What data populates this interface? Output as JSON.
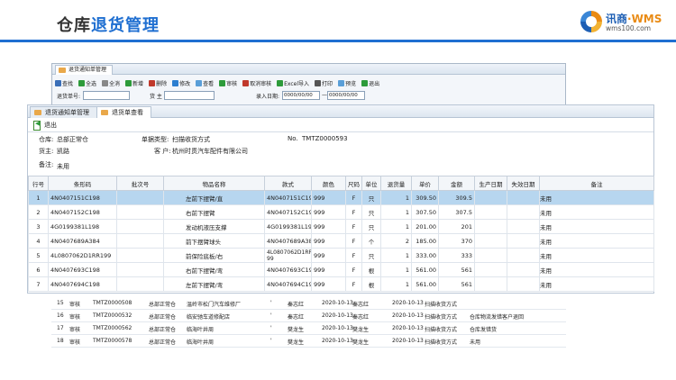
{
  "slide": {
    "title_part1": "仓库",
    "title_part2": "退货管理",
    "logo_text": "讯商",
    "logo_wms": "·WMS",
    "logo_url": "wms100.com"
  },
  "colors": {
    "accent": "#1f6fd1",
    "selected_row": "#b7d6ef",
    "logo_orange": "#e98b15"
  },
  "bg_window": {
    "tab_label": "退货通知单管理",
    "toolbar": [
      {
        "label": "查找",
        "icon": "search-icon"
      },
      {
        "label": "全选",
        "icon": "checkbox-icon"
      },
      {
        "label": "全消",
        "icon": "checkbox-empty-icon"
      },
      {
        "label": "新增",
        "icon": "add-icon"
      },
      {
        "label": "删除",
        "icon": "delete-icon"
      },
      {
        "label": "修改",
        "icon": "edit-icon"
      },
      {
        "label": "查看",
        "icon": "view-icon"
      },
      {
        "label": "审核",
        "icon": "check-icon"
      },
      {
        "label": "取消审核",
        "icon": "cancel-icon"
      },
      {
        "label": "Excel导入",
        "icon": "excel-icon"
      },
      {
        "label": "打印",
        "icon": "print-icon"
      },
      {
        "label": "预览",
        "icon": "preview-icon"
      },
      {
        "label": "退出",
        "icon": "exit-icon"
      }
    ],
    "search": {
      "order_no_label": "退货单号:",
      "owner_label": "货 主",
      "date_label": "录入日期:",
      "date_from": "0000/00/00",
      "date_to": "0000/00/00",
      "range_sep": "—"
    }
  },
  "window": {
    "tabs": [
      {
        "label": "退货通知单管理"
      },
      {
        "label": "退货单查看"
      }
    ],
    "exit_label": "退出",
    "header": {
      "warehouse_label": "仓库:",
      "warehouse_value": "总部正常仓",
      "type_label": "单据类型:",
      "type_value": "扫描收货方式",
      "no_label": "No.",
      "no_value": "TMTZ0000593",
      "owner_label": "货主:",
      "owner_value": "凯路",
      "customer_label": "客 户:",
      "customer_value": "杭州时贯汽车配件有限公司",
      "remark_label": "备注:",
      "remark_value": "未用"
    },
    "columns": [
      "行号",
      "条形码",
      "批次号",
      "物品名称",
      "款式",
      "颜色",
      "尺码",
      "单位",
      "退货量",
      "单价",
      "金额",
      "生产日期",
      "失效日期",
      "备注"
    ],
    "rows": [
      {
        "no": "1",
        "barcode": "4N0407151C198",
        "batch": "",
        "name": "左前下摆臂/直",
        "style": "4N0407151C198",
        "color": "999",
        "size": "F",
        "unit": "只",
        "qty": "1",
        "price": "309.50",
        "amount": "309.5",
        "mfg": "",
        "exp": "",
        "remark": "未用"
      },
      {
        "no": "2",
        "barcode": "4N0407152C198",
        "batch": "",
        "name": "右前下摆臂",
        "style": "4N0407152C198",
        "color": "999",
        "size": "F",
        "unit": "只",
        "qty": "1",
        "price": "307.50",
        "amount": "307.5",
        "mfg": "",
        "exp": "",
        "remark": "未用"
      },
      {
        "no": "3",
        "barcode": "4G0199381L198",
        "batch": "",
        "name": "发动机液压支撑",
        "style": "4G0199381L198",
        "color": "999",
        "size": "F",
        "unit": "只",
        "qty": "1",
        "price": "201.00",
        "amount": "201",
        "mfg": "",
        "exp": "",
        "remark": "未用"
      },
      {
        "no": "4",
        "barcode": "4N0407689A384",
        "batch": "",
        "name": "前下摆臂球头",
        "style": "4N0407689A384",
        "color": "999",
        "size": "F",
        "unit": "个",
        "qty": "2",
        "price": "185.00",
        "amount": "370",
        "mfg": "",
        "exp": "",
        "remark": "未用"
      },
      {
        "no": "5",
        "barcode": "4L0807062D1RR199",
        "batch": "",
        "name": "前保险底板/右",
        "style": "4L0807062D1RR1 99",
        "color": "999",
        "size": "F",
        "unit": "只",
        "qty": "1",
        "price": "333.00",
        "amount": "333",
        "mfg": "",
        "exp": "",
        "remark": "未用"
      },
      {
        "no": "6",
        "barcode": "4N0407693C198",
        "batch": "",
        "name": "右前下摆臂/弯",
        "style": "4N0407693C198",
        "color": "999",
        "size": "F",
        "unit": "根",
        "qty": "1",
        "price": "561.00",
        "amount": "561",
        "mfg": "",
        "exp": "",
        "remark": "未用"
      },
      {
        "no": "7",
        "barcode": "4N0407694C198",
        "batch": "",
        "name": "左前下摆臂/弯",
        "style": "4N0407694C198",
        "color": "999",
        "size": "F",
        "unit": "根",
        "qty": "1",
        "price": "561.00",
        "amount": "561",
        "mfg": "",
        "exp": "",
        "remark": "未用"
      }
    ]
  },
  "bg_list": [
    {
      "idx": "15",
      "status": "审核",
      "no": "TMTZ0000508",
      "wh": "总部正常仓",
      "cust": "温岭市松门汽车维修厂",
      "mark": "'",
      "user": "秦志红",
      "date": "2020-10-13",
      "user2": "秦志红",
      "date2": "2020-10-13",
      "type": "扫描收货方式",
      "note": ""
    },
    {
      "idx": "16",
      "status": "审核",
      "no": "TMTZ0000532",
      "wh": "总部正常仓",
      "cust": "临安驰车道修配店",
      "mark": "'",
      "user": "秦志红",
      "date": "2020-10-13",
      "user2": "秦志红",
      "date2": "2020-10-13",
      "type": "扫描收货方式",
      "note": "仓库物流发错客户退回"
    },
    {
      "idx": "17",
      "status": "审核",
      "no": "TMTZ0000562",
      "wh": "总部正常仓",
      "cust": "临海叶井周",
      "mark": "'",
      "user": "樊龙生",
      "date": "2020-10-13",
      "user2": "樊龙生",
      "date2": "2020-10-13",
      "type": "扫描收货方式",
      "note": "仓库发错货"
    },
    {
      "idx": "18",
      "status": "审核",
      "no": "TMTZ0000578",
      "wh": "总部正常仓",
      "cust": "临海叶井周",
      "mark": "'",
      "user": "樊龙生",
      "date": "2020-10-13",
      "user2": "樊龙生",
      "date2": "2020-10-13",
      "type": "扫描收货方式",
      "note": "未用"
    }
  ]
}
